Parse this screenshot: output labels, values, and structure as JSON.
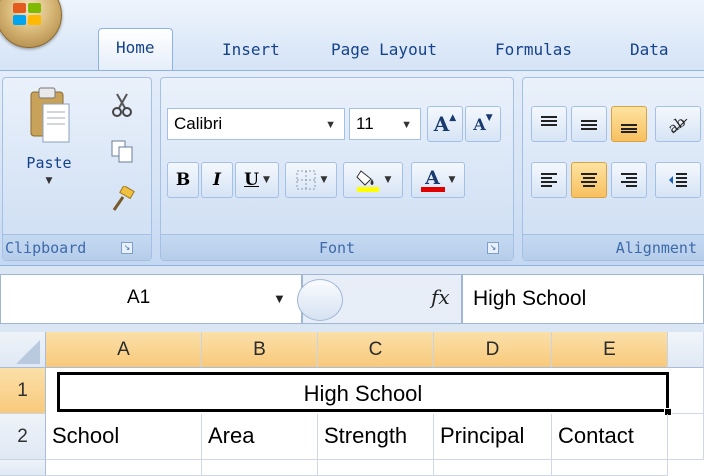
{
  "tabs": {
    "home": "Home",
    "insert": "Insert",
    "page_layout": "Page Layout",
    "formulas": "Formulas",
    "data": "Data"
  },
  "ribbon": {
    "clipboard": {
      "label": "Clipboard",
      "paste": "Paste"
    },
    "font": {
      "label": "Font",
      "name": "Calibri",
      "size": "11",
      "bold": "B",
      "italic": "I",
      "underline": "U",
      "grow_glyph": "A",
      "shrink_glyph": "A",
      "font_color_glyph": "A",
      "highlight_color": "#ffff00",
      "font_color": "#e00000"
    },
    "alignment": {
      "label": "Alignment"
    }
  },
  "formula_bar": {
    "name_box": "A1",
    "fx": "fx",
    "value": "High School"
  },
  "grid": {
    "columns": [
      "A",
      "B",
      "C",
      "D",
      "E"
    ],
    "rows": [
      "1",
      "2"
    ],
    "merged_title": "High School",
    "row2": [
      "School",
      "Area",
      "Strength",
      "Principal",
      "Contact"
    ]
  },
  "colors": {
    "accent_selected": "#f8c97b",
    "ribbon_text": "#15428b"
  }
}
